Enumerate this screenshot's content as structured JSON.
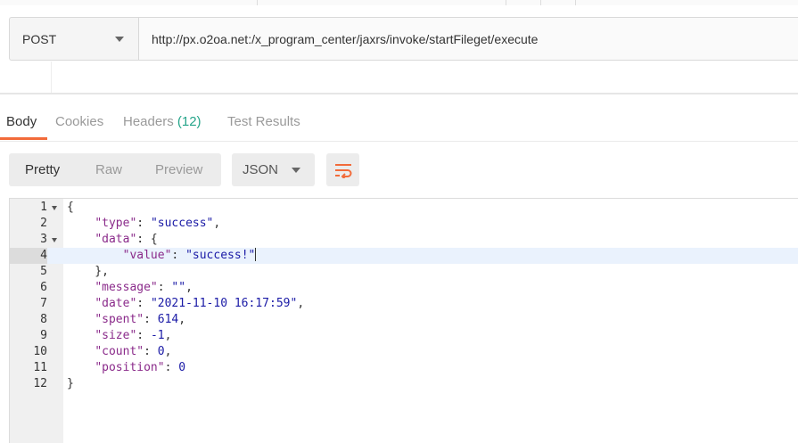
{
  "request": {
    "method": "POST",
    "url": "http://px.o2oa.net:/x_program_center/jaxrs/invoke/startFileget/execute"
  },
  "response_tabs": {
    "body": "Body",
    "cookies": "Cookies",
    "headers": "Headers",
    "headers_count": "(12)",
    "test_results": "Test Results"
  },
  "view_modes": {
    "pretty": "Pretty",
    "raw": "Raw",
    "preview": "Preview",
    "format": "JSON"
  },
  "icons": {
    "method_dropdown": "chevron-down-icon",
    "format_dropdown": "chevron-down-icon",
    "wrap": "wrap-lines-icon"
  },
  "colors": {
    "accent": "#f26b3a",
    "count": "#25a58a",
    "json_key": "#8a2a8a",
    "json_value": "#1a1aa6"
  },
  "code": {
    "line_numbers": [
      "1",
      "2",
      "3",
      "4",
      "5",
      "6",
      "7",
      "8",
      "9",
      "10",
      "11",
      "12"
    ],
    "open_brace": "{",
    "type_key": "\"type\"",
    "type_value": "\"success\"",
    "data_key": "\"data\"",
    "value_key": "\"value\"",
    "value_value": "\"success!\"",
    "message_key": "\"message\"",
    "message_value": "\"\"",
    "date_key": "\"date\"",
    "date_value": "\"2021-11-10 16:17:59\"",
    "spent_key": "\"spent\"",
    "spent_value": "614",
    "size_key": "\"size\"",
    "size_value": "-1",
    "count_key": "\"count\"",
    "count_value": "0",
    "position_key": "\"position\"",
    "position_value": "0",
    "close_brace": "}"
  }
}
